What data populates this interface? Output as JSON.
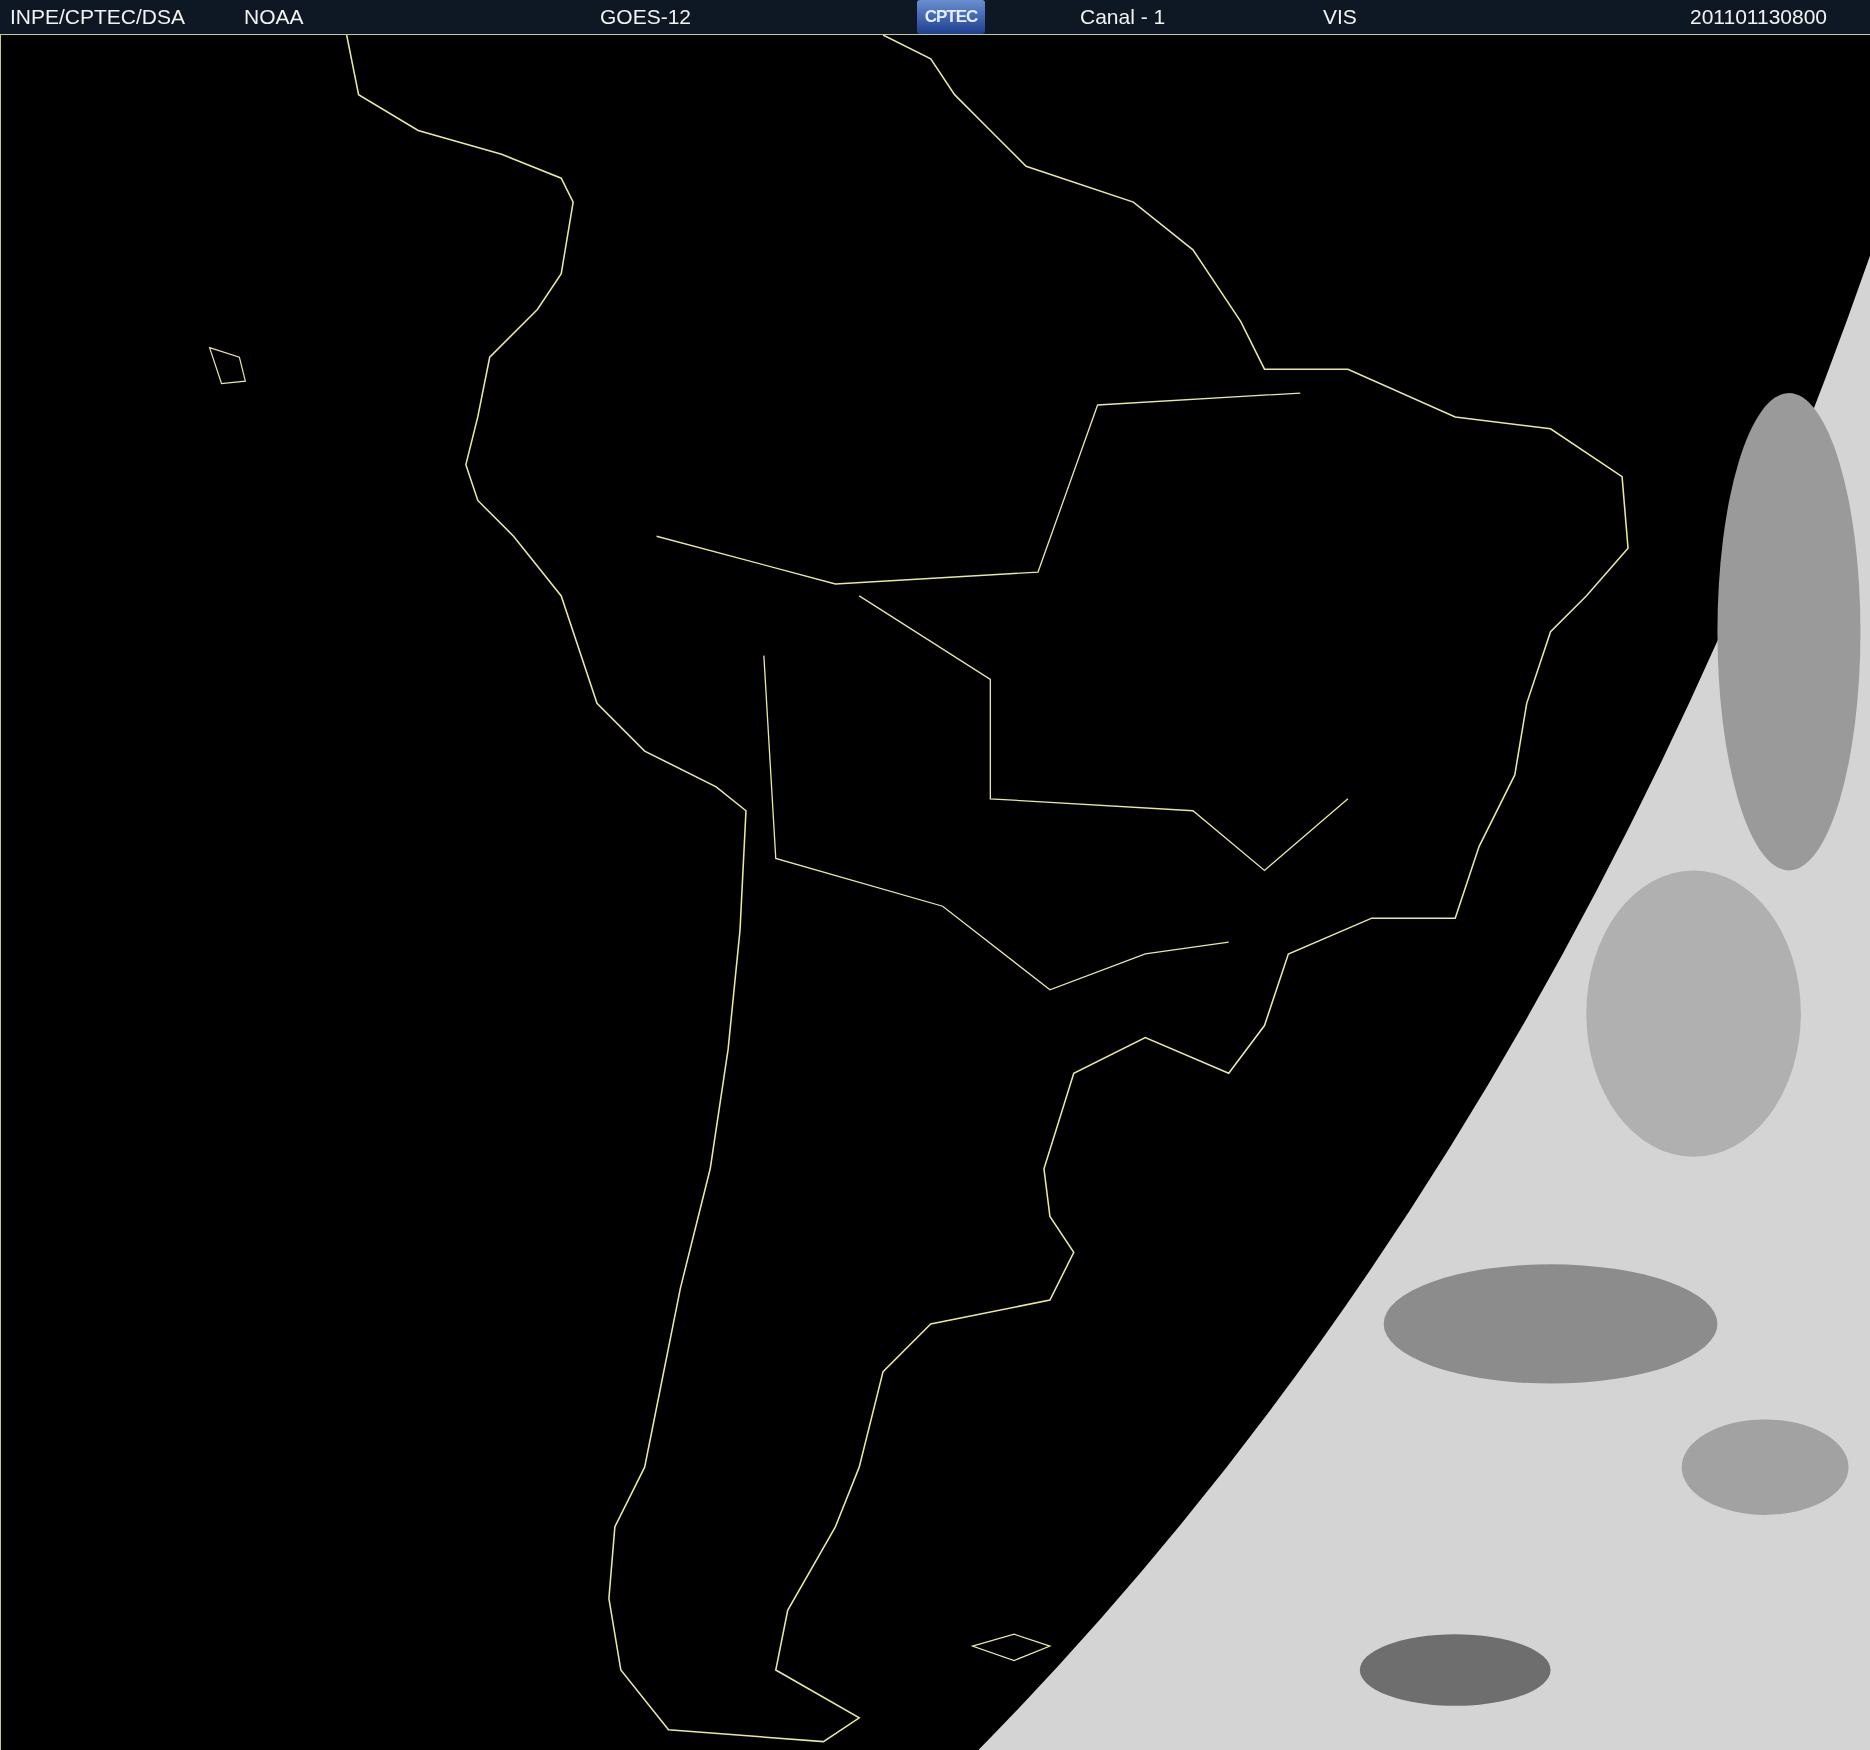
{
  "header": [
    {
      "kind": "text",
      "label": "INPE/CPTEC/DSA"
    },
    {
      "kind": "text",
      "label": "NOAA"
    },
    {
      "kind": "text",
      "label": "GOES-12"
    },
    {
      "kind": "logo",
      "label": "CPTEC"
    },
    {
      "kind": "text",
      "label": "Canal - 1"
    },
    {
      "kind": "text",
      "label": "VIS"
    },
    {
      "kind": "text",
      "label": "201101130800"
    }
  ]
}
